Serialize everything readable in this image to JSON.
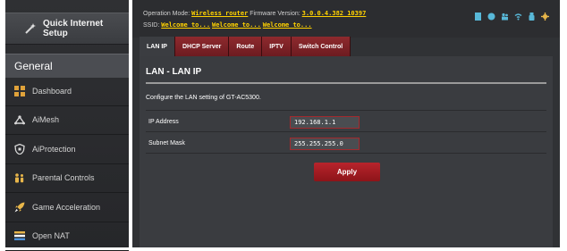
{
  "sidebar": {
    "quick_setup_label": "Quick Internet Setup",
    "section_title": "General",
    "items": [
      {
        "label": "Dashboard",
        "icon": "dashboard-icon"
      },
      {
        "label": "AiMesh",
        "icon": "aimesh-icon"
      },
      {
        "label": "AiProtection",
        "icon": "shield-icon"
      },
      {
        "label": "Parental Controls",
        "icon": "family-icon"
      },
      {
        "label": "Game Acceleration",
        "icon": "rocket-icon"
      },
      {
        "label": "Open NAT",
        "icon": "open-nat-icon"
      }
    ]
  },
  "header": {
    "operation_mode_label": "Operation Mode:",
    "operation_mode_value": "Wireless router",
    "firmware_label": "Firmware Version:",
    "firmware_value": "3.0.0.4.382_10397",
    "ssid_label": "SSID:",
    "ssid_values": [
      "Welcome to...",
      "Welcome to...",
      "Welcome to..."
    ],
    "status_icons": [
      "network-status-icon",
      "internet-status-icon",
      "users-status-icon",
      "wifi-status-icon",
      "usb-status-icon",
      "gear-icon"
    ]
  },
  "tabs": [
    {
      "label": "LAN IP",
      "active": true
    },
    {
      "label": "DHCP Server",
      "active": false
    },
    {
      "label": "Route",
      "active": false
    },
    {
      "label": "IPTV",
      "active": false
    },
    {
      "label": "Switch Control",
      "active": false
    }
  ],
  "panel": {
    "title": "LAN - LAN IP",
    "description": "Configure the LAN setting of GT-AC5300.",
    "ip_address_label": "IP Address",
    "ip_address_value": "192.168.1.1",
    "subnet_mask_label": "Subnet Mask",
    "subnet_mask_value": "255.255.255.0",
    "apply_label": "Apply"
  },
  "colors": {
    "accent_red": "#a32a2e",
    "ssid_yellow": "#ffd200",
    "panel_bg": "#3a3c40",
    "sidebar_bg": "#2f3033"
  }
}
